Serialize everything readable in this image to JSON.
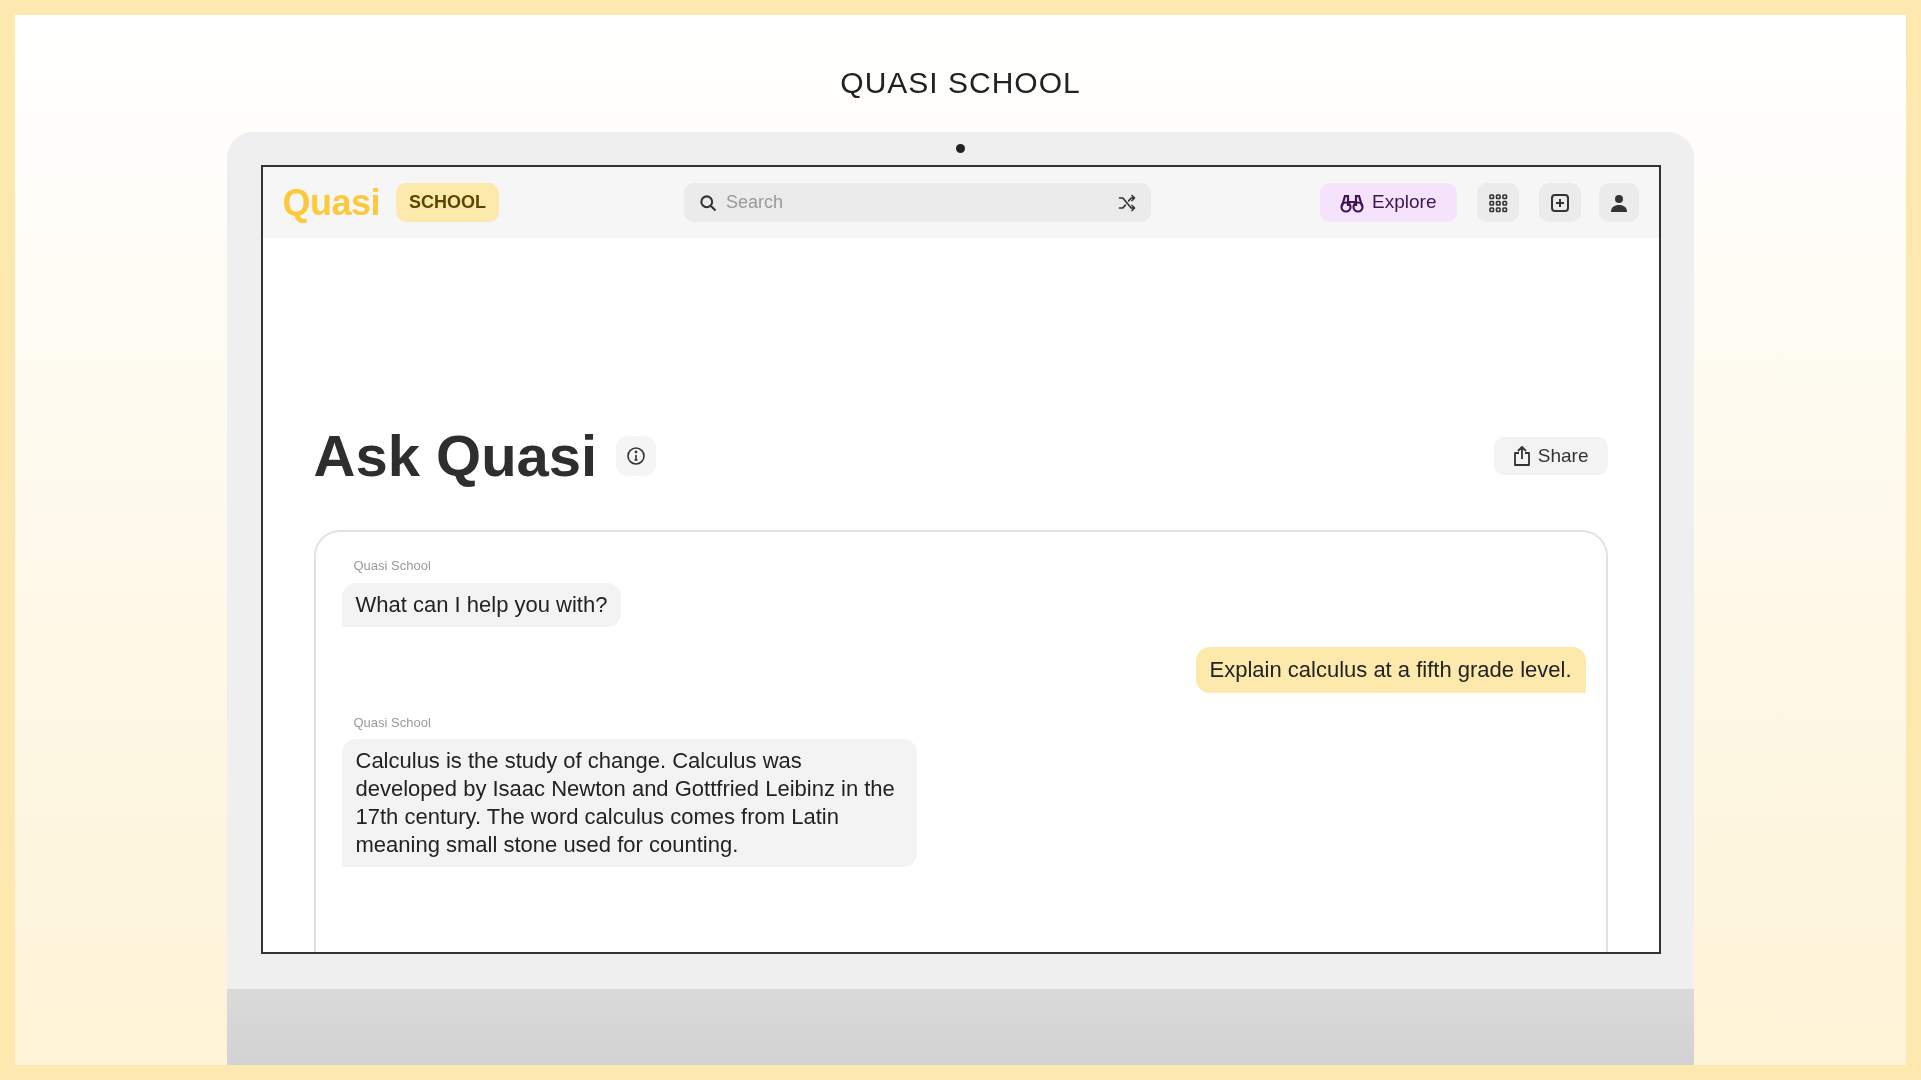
{
  "page_title": "QUASI SCHOOL",
  "navbar": {
    "logo": "Quasi",
    "badge": "SCHOOL",
    "search": {
      "placeholder": "Search"
    },
    "explore": "Explore"
  },
  "heading": "Ask Quasi",
  "share": "Share",
  "messages": [
    {
      "kind": "bot",
      "sender": "Quasi School",
      "text": "What can I help you with?"
    },
    {
      "kind": "user",
      "text": "Explain calculus at a fifth grade level."
    },
    {
      "kind": "bot",
      "sender": "Quasi School",
      "text": "Calculus is the study of change. Calculus was developed by Isaac Newton and Gottfried Leibinz in the 17th century. The word calculus comes from Latin meaning small stone used for counting."
    }
  ]
}
